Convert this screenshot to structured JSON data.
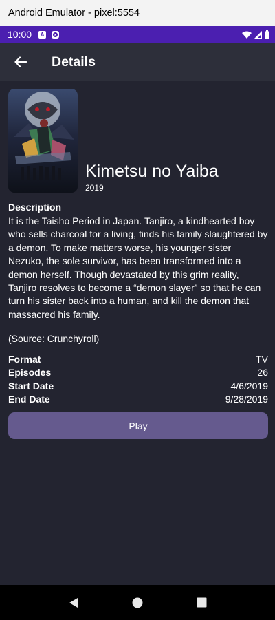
{
  "window": {
    "title": "Android Emulator - pixel:5554"
  },
  "status_bar": {
    "time": "10:00",
    "icons": [
      "app-a-icon",
      "app-play-icon"
    ],
    "right_icons": [
      "wifi-icon",
      "signal-icon",
      "battery-icon"
    ]
  },
  "app_bar": {
    "title": "Details",
    "back_icon": "arrow-left-icon"
  },
  "show": {
    "title": "Kimetsu no Yaiba",
    "year": "2019",
    "poster_icon": "anime-poster-image"
  },
  "description": {
    "heading": "Description",
    "body": "It is the Taisho Period in Japan. Tanjiro, a kindhearted boy who sells charcoal for a living, finds his family slaughtered by a demon. To make matters worse, his younger sister Nezuko, the sole survivor, has been transformed into a demon herself. Though devastated by this grim reality, Tanjiro resolves to become a “demon slayer” so that he can turn his sister back into a human, and kill the demon that massacred his family.",
    "source": "(Source: Crunchyroll)"
  },
  "info": [
    {
      "label": "Format",
      "value": "TV"
    },
    {
      "label": "Episodes",
      "value": "26"
    },
    {
      "label": "Start Date",
      "value": "4/6/2019"
    },
    {
      "label": "End Date",
      "value": "9/28/2019"
    }
  ],
  "play_button": {
    "label": "Play"
  },
  "nav_bar": {
    "icons": [
      "back-triangle-icon",
      "home-circle-icon",
      "recents-square-icon"
    ]
  },
  "colors": {
    "status_bar": "#4b1fb0",
    "app_bar": "#2d2f3a",
    "background": "#232430",
    "play_button": "#655a8e"
  }
}
